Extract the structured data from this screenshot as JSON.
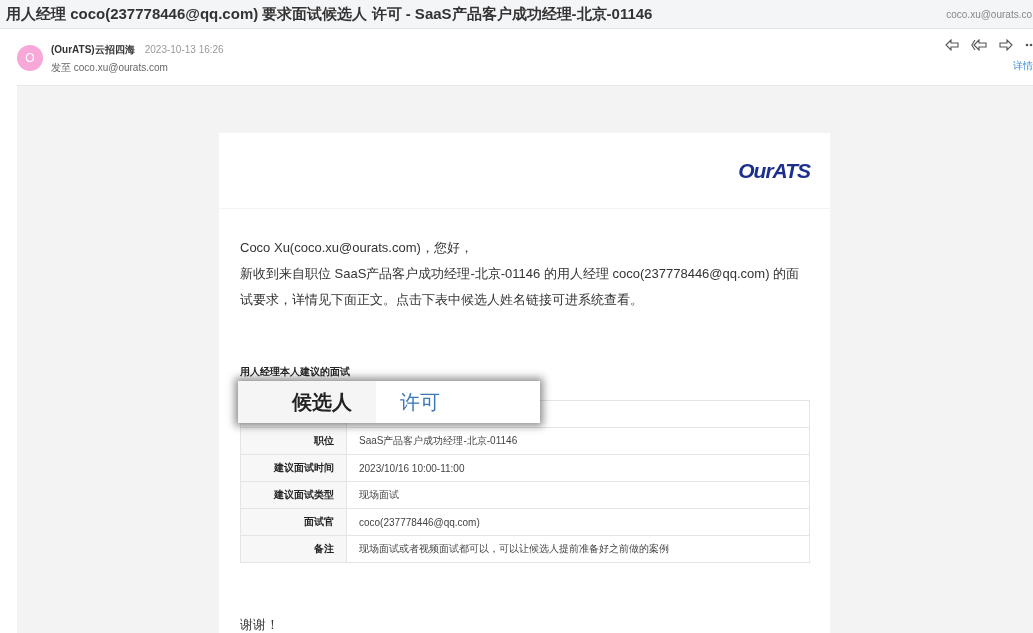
{
  "subject": "用人经理 coco(237778446@qq.com) 要求面试候选人 许可 - SaaS产品客户成功经理-北京-01146",
  "account": "coco.xu@ourats.co",
  "sender": {
    "avatar": "O",
    "name": "(OurATS)云招四海",
    "time": "2023-10-13 16:26",
    "to": "发至 coco.xu@ourats.com"
  },
  "actions": {
    "details": "详情"
  },
  "email": {
    "logo": "OurATS",
    "greeting": "Coco Xu(coco.xu@ourats.com)，您好，",
    "intro": "新收到来自职位 SaaS产品客户成功经理-北京-01146 的用人经理 coco(237778446@qq.com) 的面试要求，详情见下面正文。点击下表中候选人姓名链接可进系统查看。",
    "section_title": "用人经理本人建议的面试",
    "table": {
      "rows": [
        {
          "label": "候选人",
          "value": "许可",
          "magnified": true
        },
        {
          "label": "职位",
          "value": "SaaS产品客户成功经理-北京-01146",
          "magnified": false
        },
        {
          "label": "建议面试时间",
          "value": "2023/10/16 10:00-11:00",
          "magnified": false
        },
        {
          "label": "建议面试类型",
          "value": "现场面试",
          "magnified": false
        },
        {
          "label": "面试官",
          "value": "coco(237778446@qq.com)",
          "magnified": false
        },
        {
          "label": "备注",
          "value": "现场面试或者视频面试都可以，可以让候选人提前准备好之前做的案例",
          "magnified": false
        }
      ]
    },
    "closing": "谢谢！"
  }
}
